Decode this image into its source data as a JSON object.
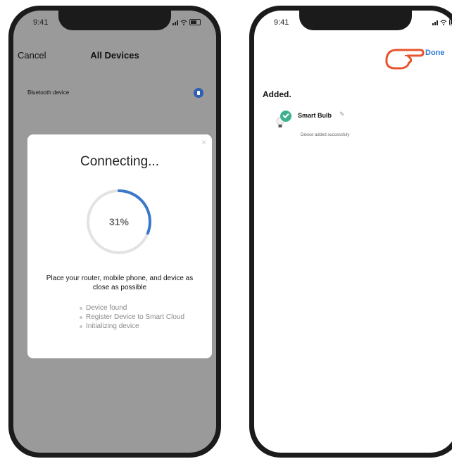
{
  "status": {
    "time": "9:41"
  },
  "connecting_screen": {
    "cancel_label": "Cancel",
    "title": "All Devices",
    "bluetooth_device_label": "Bluetooth device",
    "modal": {
      "title": "Connecting...",
      "progress_percent": 31,
      "progress_label": "31%",
      "hint": "Place your router, mobile phone, and device as close as possible",
      "steps": [
        "Device found",
        "Register Device to Smart Cloud",
        "Initializing device"
      ]
    }
  },
  "added_screen": {
    "done_label": "Done",
    "added_heading": "Added.",
    "device_name": "Smart Bulb",
    "device_status": "Device added successfuly"
  },
  "colors": {
    "accent_blue": "#2f79d6",
    "success_green": "#3fb08f",
    "pointer_orange": "#e8542c",
    "progress_blue": "#3a78c9"
  },
  "icons": [
    "signal-icon",
    "wifi-icon",
    "battery-icon",
    "bluetooth-icon",
    "close-icon",
    "pointing-hand-icon",
    "bulb-icon",
    "check-icon",
    "edit-icon"
  ]
}
